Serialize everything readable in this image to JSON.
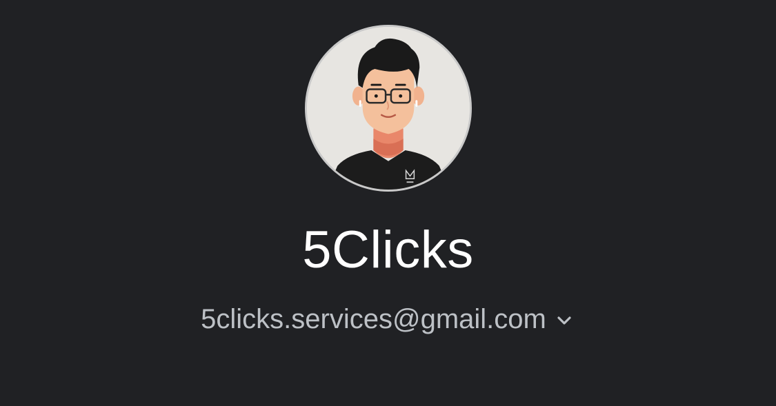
{
  "profile": {
    "display_name": "5Clicks",
    "email": "5clicks.services@gmail.com",
    "avatar_icon": "cartoon-avatar-icon",
    "switch_icon": "chevron-down-icon"
  },
  "colors": {
    "background": "#202124",
    "name_text": "#ffffff",
    "email_text": "#bdc1c6",
    "avatar_bg": "#e7e5e1"
  }
}
